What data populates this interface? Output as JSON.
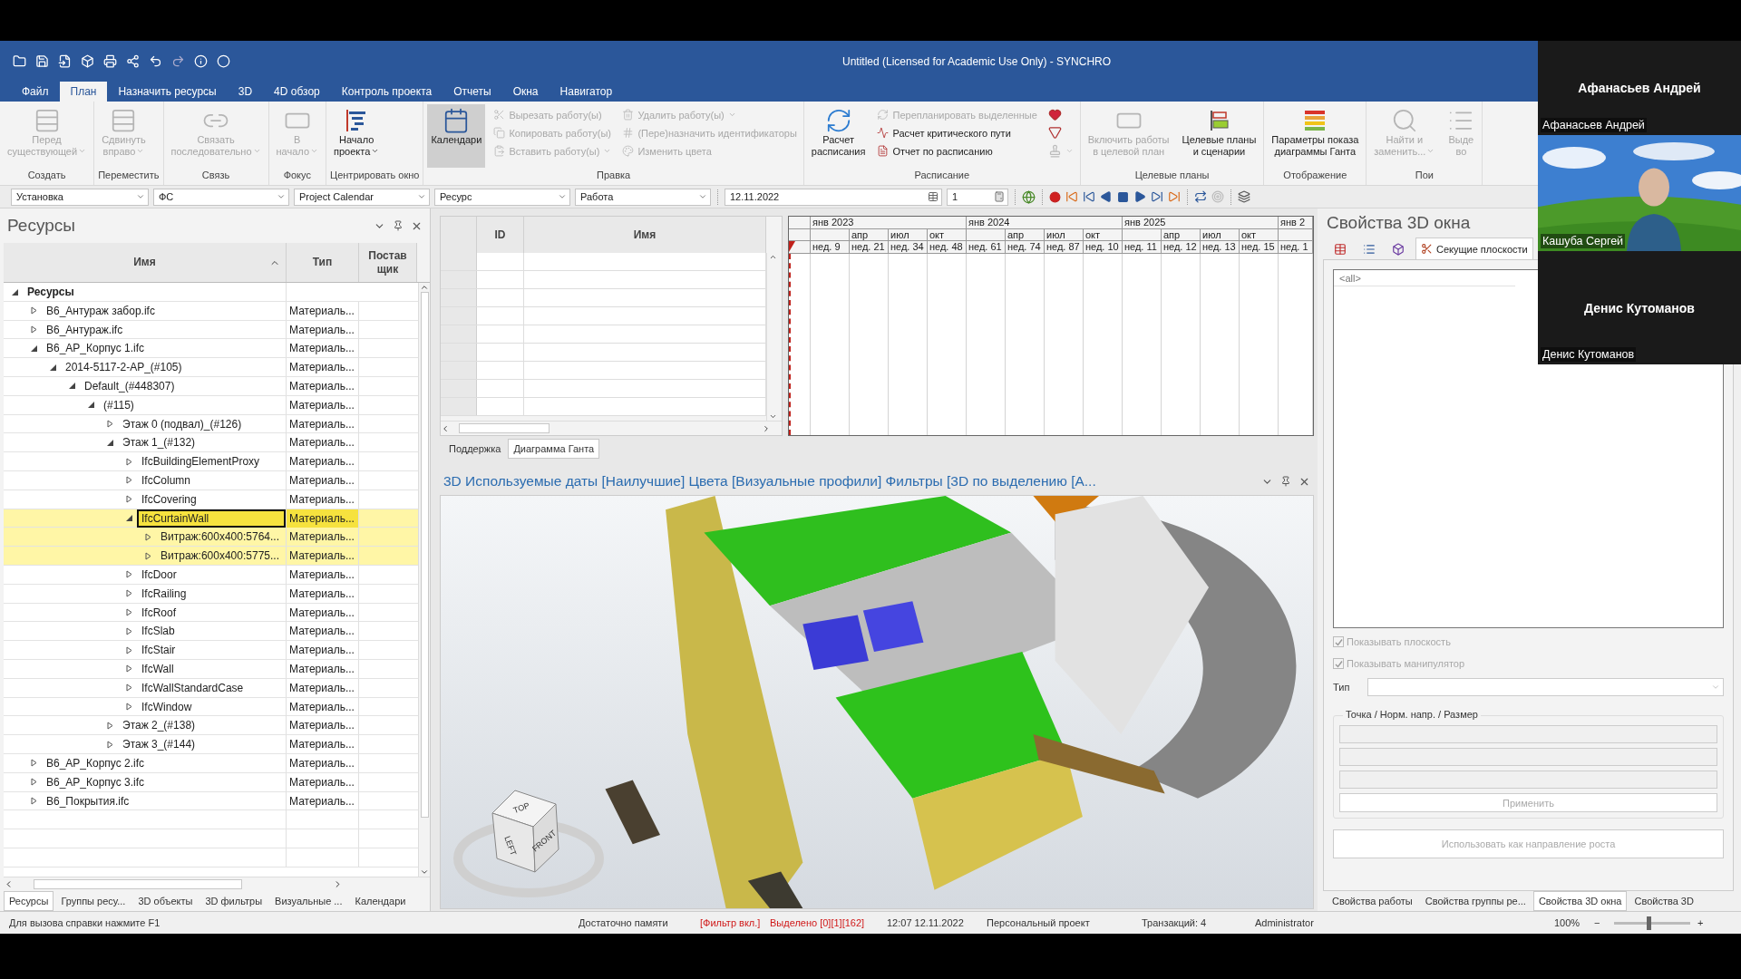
{
  "window": {
    "title": "Untitled (Licensed for Academic Use Only) - SYNCHRO"
  },
  "menu_tabs": [
    {
      "label": "Файл",
      "selected": false
    },
    {
      "label": "План",
      "selected": true
    },
    {
      "label": "Назначить ресурсы",
      "selected": false
    },
    {
      "label": "3D",
      "selected": false
    },
    {
      "label": "4D обзор",
      "selected": false
    },
    {
      "label": "Контроль проекта",
      "selected": false
    },
    {
      "label": "Отчеты",
      "selected": false
    },
    {
      "label": "Окна",
      "selected": false
    },
    {
      "label": "Навигатор",
      "selected": false
    }
  ],
  "ribbon": {
    "groups": [
      {
        "label": "Создать",
        "items": [
          {
            "kind": "large",
            "label": "Перед\nсуществующей",
            "disabled": true,
            "dropdown": true,
            "pressed": false
          }
        ]
      },
      {
        "label": "Переместить",
        "items": [
          {
            "kind": "large",
            "label": "Сдвинуть\nвправо",
            "disabled": true,
            "dropdown": true,
            "pressed": false
          }
        ]
      },
      {
        "label": "Связь",
        "items": [
          {
            "kind": "large",
            "label": "Связать\nпоследовательно",
            "disabled": true,
            "dropdown": true,
            "pressed": false
          }
        ]
      },
      {
        "label": "Фокус",
        "items": [
          {
            "kind": "large",
            "label": "В\nначало",
            "disabled": true,
            "dropdown": true,
            "pressed": false
          }
        ]
      },
      {
        "label": "Центрировать окно",
        "items": [
          {
            "kind": "large",
            "label": "Начало\nпроекта",
            "disabled": false,
            "dropdown": true,
            "pressed": false
          }
        ]
      },
      {
        "label": "Правка",
        "items": [
          {
            "kind": "large",
            "label": "Календари",
            "disabled": false,
            "dropdown": false,
            "pressed": true
          },
          {
            "kind": "stack",
            "items": [
              {
                "label": "Вырезать работу(ы)",
                "disabled": true,
                "dropdown": false
              },
              {
                "label": "Копировать работу(ы)",
                "disabled": true,
                "dropdown": false
              },
              {
                "label": "Вставить работу(ы)",
                "disabled": true,
                "dropdown": true
              }
            ]
          },
          {
            "kind": "stack",
            "items": [
              {
                "label": "Удалить работу(ы)",
                "disabled": true,
                "dropdown": true
              },
              {
                "label": "(Пере)назначить идентификаторы",
                "disabled": true,
                "dropdown": false
              },
              {
                "label": "Изменить цвета",
                "disabled": true,
                "dropdown": false
              }
            ]
          }
        ]
      },
      {
        "label": "Расписание",
        "items": [
          {
            "kind": "large",
            "label": "Расчет\nрасписания",
            "disabled": false,
            "dropdown": false,
            "pressed": false
          },
          {
            "kind": "stack",
            "items": [
              {
                "label": "Перепланировать выделенные",
                "disabled": true,
                "dropdown": false
              },
              {
                "label": "Расчет критического пути",
                "disabled": false,
                "dropdown": false
              },
              {
                "label": "Отчет по расписанию",
                "disabled": false,
                "dropdown": false
              }
            ]
          },
          {
            "kind": "icons",
            "items": [
              {
                "disabled": false,
                "dropdown": false
              },
              {
                "disabled": false,
                "dropdown": false
              },
              {
                "disabled": true,
                "dropdown": true
              }
            ]
          }
        ]
      },
      {
        "label": "Целевые планы",
        "items": [
          {
            "kind": "large",
            "label": "Включить работы\nв целевой план",
            "disabled": true,
            "dropdown": false,
            "pressed": false
          },
          {
            "kind": "large",
            "label": "Целевые планы\nи сценарии",
            "disabled": false,
            "dropdown": false,
            "pressed": false
          }
        ]
      },
      {
        "label": "Отображение",
        "items": [
          {
            "kind": "large",
            "label": "Параметры показа\nдиаграммы Ганта",
            "disabled": false,
            "dropdown": false,
            "pressed": false
          }
        ]
      },
      {
        "label": "Пои",
        "items": [
          {
            "kind": "large",
            "label": "Найти и\nзаменить...",
            "disabled": true,
            "dropdown": true,
            "pressed": false
          },
          {
            "kind": "large",
            "label": "Выде\nво",
            "disabled": true,
            "dropdown": false,
            "pressed": false
          }
        ]
      }
    ]
  },
  "toolbar": {
    "selects": [
      "Установка",
      "ФС",
      "Project Calendar",
      "Ресурс",
      "Работа"
    ],
    "date": "12.11.2022",
    "counter": "1"
  },
  "resources_panel": {
    "title": "Ресурсы",
    "columns": [
      {
        "label": "Имя",
        "sorted": true
      },
      {
        "label": "Тип",
        "sorted": false
      },
      {
        "label": "Постав\nщик",
        "sorted": false
      }
    ],
    "tree": [
      {
        "name": "Ресурсы",
        "expanded": true,
        "selected": false,
        "current": false,
        "children": [
          {
            "name": "В6_Антураж забор.ifc",
            "type": "Материаль...",
            "expanded": false,
            "selected": false,
            "current": false
          },
          {
            "name": "В6_Антураж.ifc",
            "type": "Материаль...",
            "expanded": false,
            "selected": false,
            "current": false
          },
          {
            "name": "В6_АР_Корпус 1.ifc",
            "type": "Материаль...",
            "expanded": true,
            "selected": false,
            "current": false,
            "children": [
              {
                "name": "2014-5117-2-АР_(#105)",
                "type": "Материаль...",
                "expanded": true,
                "selected": false,
                "current": false,
                "children": [
                  {
                    "name": "Default_(#448307)",
                    "type": "Материаль...",
                    "expanded": true,
                    "selected": false,
                    "current": false,
                    "children": [
                      {
                        "name": "(#115)",
                        "type": "Материаль...",
                        "expanded": true,
                        "selected": false,
                        "current": false,
                        "children": [
                          {
                            "name": "Этаж 0 (подвал)_(#126)",
                            "type": "Материаль...",
                            "expanded": false,
                            "selected": false,
                            "current": false
                          },
                          {
                            "name": "Этаж 1_(#132)",
                            "type": "Материаль...",
                            "expanded": true,
                            "selected": false,
                            "current": false,
                            "children": [
                              {
                                "name": "IfcBuildingElementProxy",
                                "type": "Материаль...",
                                "expanded": false,
                                "selected": false,
                                "current": false
                              },
                              {
                                "name": "IfcColumn",
                                "type": "Материаль...",
                                "expanded": false,
                                "selected": false,
                                "current": false
                              },
                              {
                                "name": "IfcCovering",
                                "type": "Материаль...",
                                "expanded": false,
                                "selected": false,
                                "current": false
                              },
                              {
                                "name": "IfcCurtainWall",
                                "type": "Материаль...",
                                "expanded": true,
                                "selected": true,
                                "current": true,
                                "children": [
                                  {
                                    "name": "Витраж:600x400:5764...",
                                    "type": "Материаль...",
                                    "expanded": false,
                                    "selected": true,
                                    "current": false
                                  },
                                  {
                                    "name": "Витраж:600x400:5775...",
                                    "type": "Материаль...",
                                    "expanded": false,
                                    "selected": true,
                                    "current": false
                                  }
                                ]
                              },
                              {
                                "name": "IfcDoor",
                                "type": "Материаль...",
                                "expanded": false,
                                "selected": false,
                                "current": false
                              },
                              {
                                "name": "IfcRailing",
                                "type": "Материаль...",
                                "expanded": false,
                                "selected": false,
                                "current": false
                              },
                              {
                                "name": "IfcRoof",
                                "type": "Материаль...",
                                "expanded": false,
                                "selected": false,
                                "current": false
                              },
                              {
                                "name": "IfcSlab",
                                "type": "Материаль...",
                                "expanded": false,
                                "selected": false,
                                "current": false
                              },
                              {
                                "name": "IfcStair",
                                "type": "Материаль...",
                                "expanded": false,
                                "selected": false,
                                "current": false
                              },
                              {
                                "name": "IfcWall",
                                "type": "Материаль...",
                                "expanded": false,
                                "selected": false,
                                "current": false
                              },
                              {
                                "name": "IfcWallStandardCase",
                                "type": "Материаль...",
                                "expanded": false,
                                "selected": false,
                                "current": false
                              },
                              {
                                "name": "IfcWindow",
                                "type": "Материаль...",
                                "expanded": false,
                                "selected": false,
                                "current": false
                              }
                            ]
                          },
                          {
                            "name": "Этаж 2_(#138)",
                            "type": "Материаль...",
                            "expanded": false,
                            "selected": false,
                            "current": false
                          },
                          {
                            "name": "Этаж 3_(#144)",
                            "type": "Материаль...",
                            "expanded": false,
                            "selected": false,
                            "current": false
                          }
                        ]
                      }
                    ]
                  }
                ]
              }
            ]
          },
          {
            "name": "В6_АР_Корпус 2.ifc",
            "type": "Материаль...",
            "expanded": false,
            "selected": false,
            "current": false
          },
          {
            "name": "В6_АР_Корпус 3.ifc",
            "type": "Материаль...",
            "expanded": false,
            "selected": false,
            "current": false
          },
          {
            "name": "В6_Покрытия.ifc",
            "type": "Материаль...",
            "expanded": false,
            "selected": false,
            "current": false
          }
        ]
      }
    ],
    "tabs": [
      {
        "label": "Ресурсы",
        "selected": true
      },
      {
        "label": "Группы ресу...",
        "selected": false
      },
      {
        "label": "3D объекты",
        "selected": false
      },
      {
        "label": "3D фильтры",
        "selected": false
      },
      {
        "label": "Визуальные ...",
        "selected": false
      },
      {
        "label": "Календари",
        "selected": false
      }
    ]
  },
  "task_grid": {
    "columns": [
      "ID",
      "Имя"
    ]
  },
  "gantt": {
    "years": [
      {
        "label": "янв 2023",
        "quarters": [
          {
            "week": "нед. 9"
          },
          {
            "month": "апр",
            "week": "нед. 21"
          },
          {
            "month": "июл",
            "week": "нед. 34"
          },
          {
            "month": "окт",
            "week": "нед. 48"
          }
        ]
      },
      {
        "label": "янв 2024",
        "quarters": [
          {
            "week": "нед. 61"
          },
          {
            "month": "апр",
            "week": "нед. 74"
          },
          {
            "month": "июл",
            "week": "нед. 87"
          },
          {
            "month": "окт",
            "week": "нед. 10"
          }
        ]
      },
      {
        "label": "янв 2025",
        "quarters": [
          {
            "week": "нед. 11"
          },
          {
            "month": "апр",
            "week": "нед. 12"
          },
          {
            "month": "июл",
            "week": "нед. 13"
          },
          {
            "month": "окт",
            "week": "нед. 15"
          }
        ]
      },
      {
        "label": "янв 2",
        "quarters": [
          {
            "week": "нед. 1"
          }
        ]
      }
    ]
  },
  "lower_tabs": [
    {
      "label": "Поддержка",
      "selected": false
    },
    {
      "label": "Диаграмма Ганта",
      "selected": true
    }
  ],
  "view3d": {
    "title": "3D Используемые даты [Наилучшие] Цвета [Визуальные профили] Фильтры [3D по выделению [A...",
    "cube": [
      "TOP",
      "LEFT",
      "FRONT"
    ]
  },
  "properties_panel": {
    "title": "Свойства 3D окна",
    "tabs": [
      {
        "selected": false
      },
      {
        "selected": false
      },
      {
        "selected": false
      },
      {
        "label": "Секущие плоскости",
        "selected": true
      }
    ],
    "list_items": [
      "<all>"
    ],
    "checkboxes": [
      {
        "label": "Показывать плоскость",
        "checked": true,
        "disabled": true
      },
      {
        "label": "Показывать манипулятор",
        "checked": true,
        "disabled": true
      }
    ],
    "type_label": "Тип",
    "group_title": "Точка / Норм. напр. / Размер",
    "apply_button": {
      "label": "Применить",
      "disabled": true
    },
    "growth_button": {
      "label": "Использовать как направление роста",
      "disabled": true
    },
    "bottom_tabs": [
      {
        "label": "Свойства работы",
        "selected": false
      },
      {
        "label": "Свойства группы ре...",
        "selected": false
      },
      {
        "label": "Свойства 3D окна",
        "selected": true
      },
      {
        "label": "Свойства 3D",
        "selected": false
      }
    ]
  },
  "status_bar": {
    "items": [
      {
        "kind": "plain",
        "text": "Для вызова справки нажмите F1"
      },
      {
        "kind": "plain",
        "text": "Достаточно памяти"
      },
      {
        "kind": "alert",
        "text": "[Фильтр вкл.]"
      },
      {
        "kind": "alert",
        "text": "Выделено [0][1][162]"
      },
      {
        "kind": "plain",
        "text": "12:07 12.11.2022"
      },
      {
        "kind": "plain",
        "text": "Персональный проект"
      },
      {
        "kind": "plain",
        "text": "Транзакций: 4"
      },
      {
        "kind": "plain",
        "text": "Administrator"
      }
    ],
    "zoom": {
      "reading": "100%",
      "zoom_out": "−",
      "zoom_in": "+",
      "level": 0.45
    }
  },
  "video_tiles": [
    {
      "kind": "avatar",
      "name": "Афанасьев Андрей",
      "caption": "Афанасьев Андрей"
    },
    {
      "kind": "video",
      "caption": "Кашуба Сергей"
    },
    {
      "kind": "avatar",
      "name": "Денис Кутоманов",
      "caption": "Денис Кутоманов"
    }
  ]
}
